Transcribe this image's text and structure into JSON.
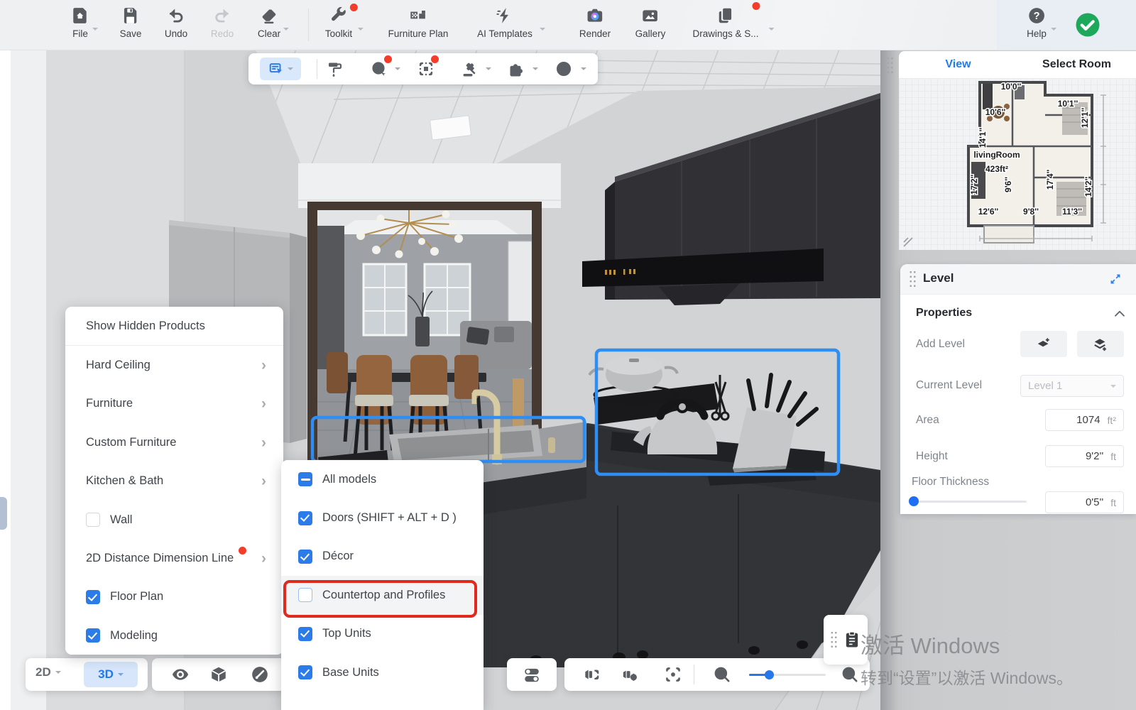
{
  "toolbar": {
    "file": "File",
    "save": "Save",
    "undo": "Undo",
    "redo": "Redo",
    "clear": "Clear",
    "toolkit": "Toolkit",
    "furniture_plan": "Furniture Plan",
    "ai_templates": "AI Templates",
    "render": "Render",
    "gallery": "Gallery",
    "drawings": "Drawings & S...",
    "help": "Help"
  },
  "subtoolbar": {
    "icons": [
      "annotate-select",
      "paint-roller",
      "replace-sync-globe",
      "marquee-select",
      "gavel",
      "plugin-puzzle",
      "target-rings"
    ]
  },
  "right_panel": {
    "tabs": {
      "view": "View",
      "select_room": "Select Room"
    },
    "floorplan": {
      "room_label": "livingRoom",
      "room_area": "423ft²",
      "dims": {
        "t1": "10'0''",
        "t2": "10'6''",
        "tr": "10'1''",
        "l1": "14'1''",
        "r1": "12'1''",
        "l2": "17'2''",
        "m1": "9'6''",
        "m2": "17'4''",
        "r2": "14'2''",
        "b1": "12'6''",
        "b2": "9'8''",
        "b3": "11'3''"
      }
    },
    "level": {
      "title": "Level",
      "section": "Properties",
      "add_level": "Add Level",
      "current_level": "Current Level",
      "current_level_value": "Level 1",
      "area": "Area",
      "area_value": "1074",
      "area_unit": "ft²",
      "height": "Height",
      "height_value": "9'2''",
      "height_unit": "ft",
      "floor_thickness": "Floor Thickness",
      "floor_thickness_value": "0'5''",
      "floor_thickness_unit": "ft"
    }
  },
  "context_menu": {
    "items": [
      {
        "label": "Show Hidden Products"
      },
      {
        "label": "Hard Ceiling"
      },
      {
        "label": "Furniture"
      },
      {
        "label": "Custom Furniture"
      },
      {
        "label": "Kitchen & Bath"
      },
      {
        "label": "Wall",
        "checked": false
      },
      {
        "label": "2D Distance Dimension Line"
      },
      {
        "label": "Floor Plan",
        "checked": true
      },
      {
        "label": "Modeling",
        "checked": true
      }
    ]
  },
  "display_menu": {
    "items": [
      {
        "label": "All models",
        "state": "indeterminate"
      },
      {
        "label": "Doors (SHIFT + ALT + D )",
        "state": "checked"
      },
      {
        "label": "Décor",
        "state": "checked"
      },
      {
        "label": "Countertop and Profiles",
        "state": "unchecked",
        "highlighted": true
      },
      {
        "label": "Top Units",
        "state": "checked"
      },
      {
        "label": "Base Units",
        "state": "checked"
      }
    ]
  },
  "view_switch": {
    "mode_2d": "2D",
    "mode_3d": "3D"
  },
  "watermark": {
    "line1": "激活 Windows",
    "line2": "转到“设置”以激活 Windows。"
  },
  "colors": {
    "accent_blue": "#2478ea",
    "selection_blue": "#2f8ef4",
    "badge_red": "#f53b2a",
    "highlight_red": "#e02a1d",
    "ok_green": "#1ea85b"
  }
}
